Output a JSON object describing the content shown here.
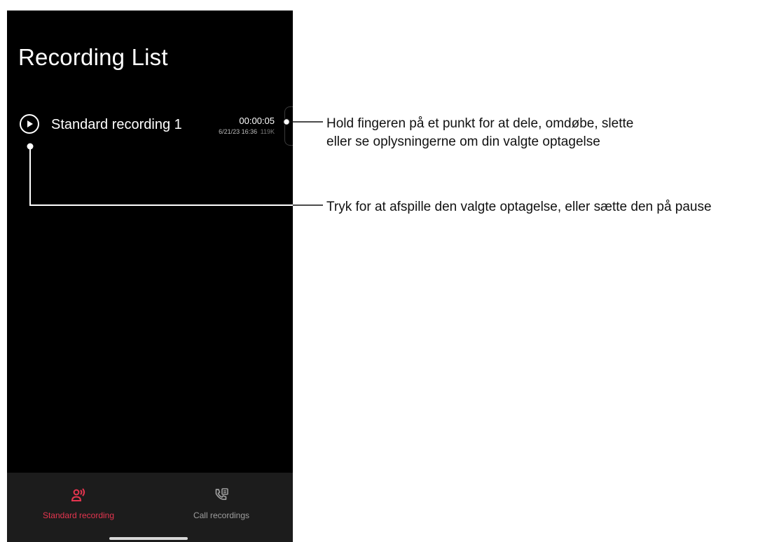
{
  "screen": {
    "title": "Recording List"
  },
  "recordings": [
    {
      "name": "Standard recording 1",
      "duration": "00:00:05",
      "datetime": "6/21/23 16:36",
      "size": "119K"
    }
  ],
  "bottom_nav": {
    "tabs": [
      {
        "label": "Standard recording",
        "icon": "person-voice-icon",
        "active": true
      },
      {
        "label": "Call recordings",
        "icon": "phone-list-icon",
        "active": false
      }
    ]
  },
  "callouts": {
    "item_menu_line1": "Hold fingeren på et punkt for at dele, omdøbe, slette",
    "item_menu_line2": "eller se oplysningerne om din valgte optagelse",
    "play_pause": "Tryk for at afspille den valgte optagelse, eller sætte den på pause"
  },
  "colors": {
    "accent": "#e5354f",
    "inactive": "#9e9e9e",
    "background": "#000000",
    "nav_background": "#1c1c1c"
  }
}
